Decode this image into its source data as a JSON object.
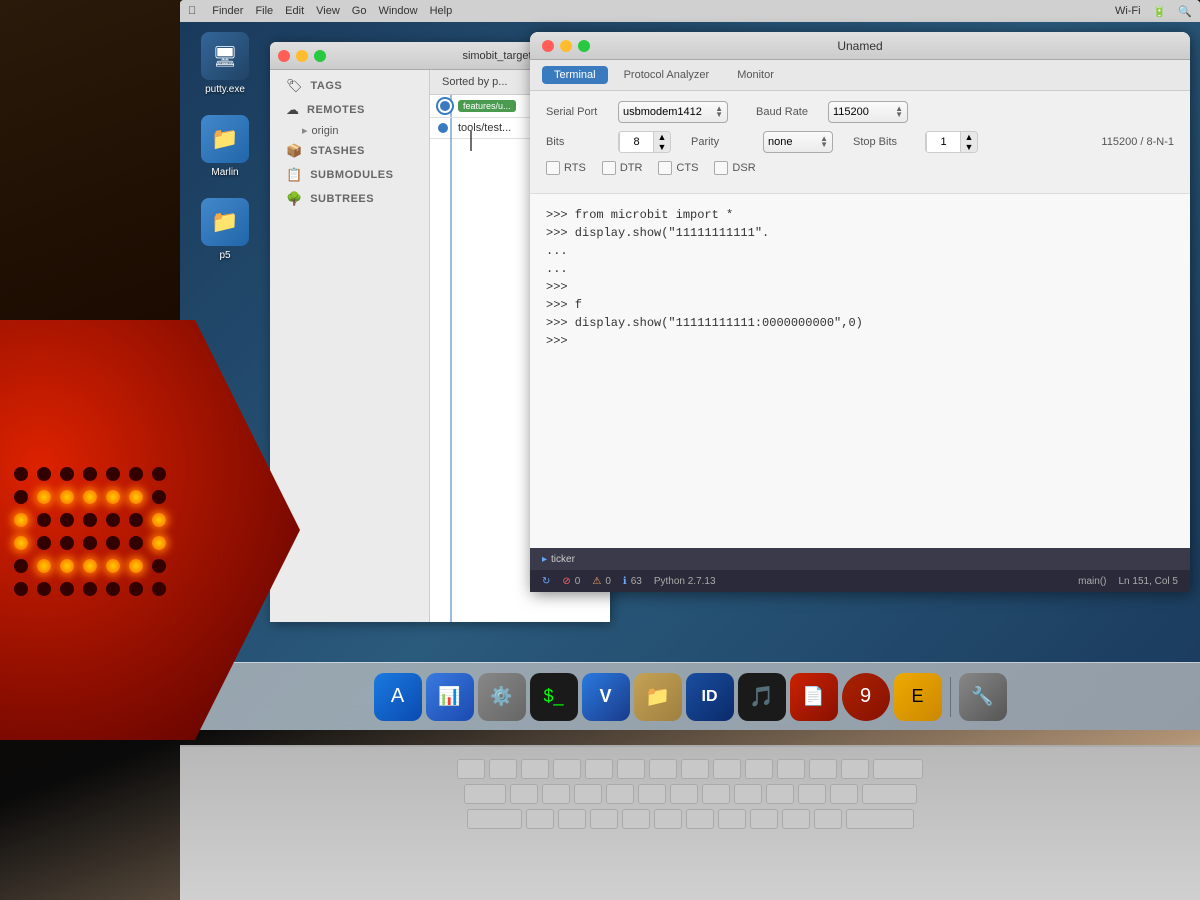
{
  "bg": {
    "description": "Dark desk background with laptop and red hexagonal LED board"
  },
  "desktop": {
    "icons": [
      {
        "id": "putty",
        "label": "putty.exe",
        "emoji": "🖥️",
        "color": "#336699"
      },
      {
        "id": "marlin",
        "label": "Marlin",
        "emoji": "📁",
        "color": "#4488cc"
      },
      {
        "id": "p5",
        "label": "p5",
        "emoji": "📁",
        "color": "#4488cc"
      }
    ]
  },
  "sourcetree": {
    "title": "simobit_target",
    "traffic_lights": [
      "close",
      "minimize",
      "maximize"
    ],
    "sidebar": {
      "items": [
        {
          "id": "tags",
          "icon": "🏷",
          "label": "TAGS"
        },
        {
          "id": "remotes",
          "icon": "☁️",
          "label": "REMOTES"
        },
        {
          "id": "origin",
          "label": "origin",
          "indent": true
        },
        {
          "id": "stashes",
          "icon": "📦",
          "label": "STASHES"
        },
        {
          "id": "submodules",
          "icon": "📋",
          "label": "SUBMODULES"
        },
        {
          "id": "subtrees",
          "icon": "🌳",
          "label": "SUBTREES"
        }
      ]
    },
    "sorted_by_label": "Sorted by",
    "commits": [
      {
        "id": "1",
        "branch": "features/u",
        "color": "#4a9a4f"
      },
      {
        "id": "2",
        "text": "tools/test"
      }
    ]
  },
  "serial_terminal": {
    "title": "Unamed",
    "tabs": [
      {
        "id": "terminal",
        "label": "Terminal",
        "active": true
      },
      {
        "id": "protocol_analyzer",
        "label": "Protocol Analyzer",
        "active": false
      },
      {
        "id": "monitor",
        "label": "Monitor",
        "active": false
      }
    ],
    "controls": {
      "serial_port_label": "Serial Port",
      "serial_port_value": "usbmodem1412",
      "baud_rate_label": "Baud Rate",
      "baud_rate_value": "115200",
      "bits_label": "Bits",
      "bits_value": "8",
      "parity_label": "Parity",
      "parity_value": "none",
      "stop_bits_label": "Stop Bits",
      "stop_bits_value": "1",
      "baud_summary": "115200 / 8-N-1",
      "checkboxes": [
        {
          "id": "rts",
          "label": "RTS",
          "checked": false
        },
        {
          "id": "dtr",
          "label": "DTR",
          "checked": false
        },
        {
          "id": "cts",
          "label": "CTS",
          "checked": false
        },
        {
          "id": "dsr",
          "label": "DSR",
          "checked": false
        }
      ]
    },
    "terminal_lines": [
      ">>> from microbit import *",
      ">>> display.show(\"11111111111\".",
      "...",
      "...",
      ">>>",
      ">>> f",
      ">>> display.show(\"11111111111:0000000000\",0)",
      ">>>"
    ],
    "ticker": "ticker",
    "status": {
      "reconnect_icon": "↻",
      "errors": "0",
      "warnings": "0",
      "info": "63",
      "language": "Python 2.7.13",
      "function": "main()",
      "position": "Ln 151, Col 5"
    }
  },
  "dock": {
    "items": [
      {
        "id": "app-store",
        "emoji": "🅐",
        "label": "App Store"
      },
      {
        "id": "keynote",
        "emoji": "📊",
        "label": "Keynote"
      },
      {
        "id": "system-prefs",
        "emoji": "⚙️",
        "label": "System Preferences"
      },
      {
        "id": "terminal",
        "emoji": "💻",
        "label": "Terminal"
      },
      {
        "id": "vscode",
        "emoji": "🆚",
        "label": "VS Code"
      },
      {
        "id": "folder",
        "emoji": "📁",
        "label": "Folder"
      },
      {
        "id": "bankid",
        "emoji": "🔐",
        "label": "BankID"
      },
      {
        "id": "spotify",
        "emoji": "🎵",
        "label": "Spotify"
      },
      {
        "id": "acrobat",
        "emoji": "📄",
        "label": "Acrobat"
      },
      {
        "id": "app9",
        "emoji": "🔍",
        "label": "App"
      },
      {
        "id": "app10",
        "emoji": "📝",
        "label": "Notes"
      },
      {
        "id": "app11",
        "emoji": "✏️",
        "label": "Editor"
      }
    ]
  }
}
